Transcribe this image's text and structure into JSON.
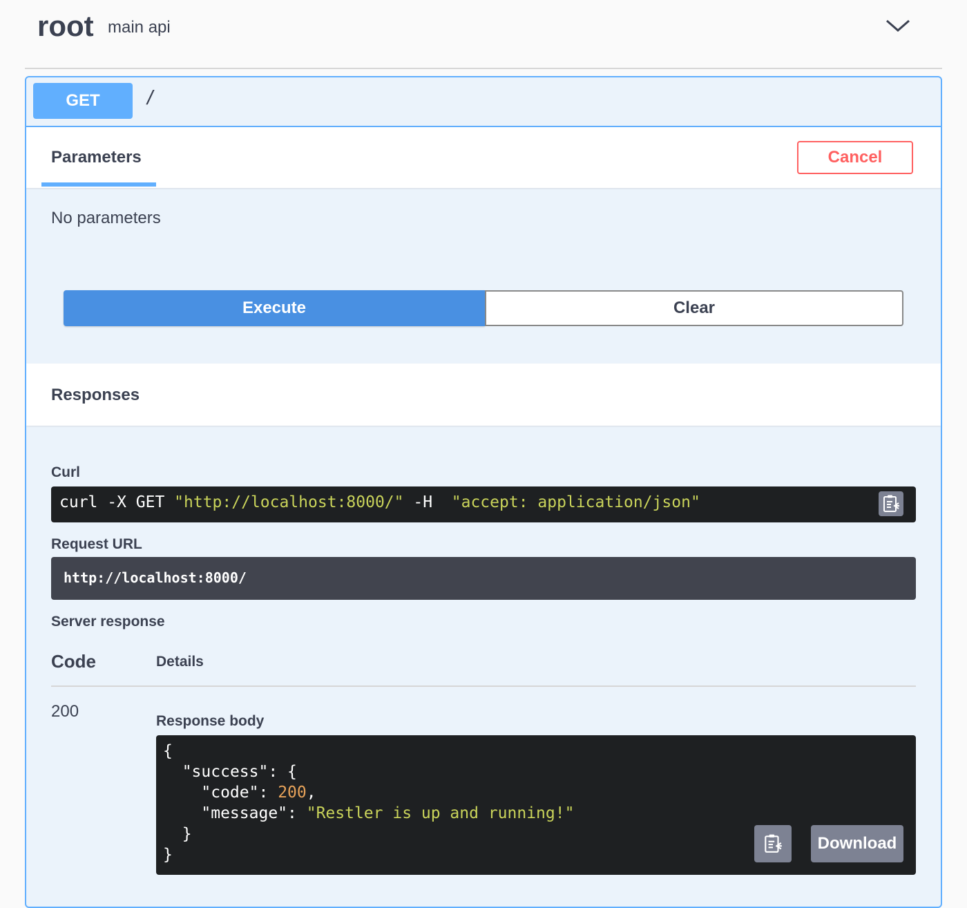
{
  "tag": {
    "name": "root",
    "description": "main api"
  },
  "operation": {
    "method": "GET",
    "path": "/"
  },
  "parameters": {
    "tab_label": "Parameters",
    "cancel_label": "Cancel",
    "empty_text": "No parameters",
    "execute_label": "Execute",
    "clear_label": "Clear"
  },
  "responses": {
    "title": "Responses",
    "curl_label": "Curl",
    "curl": {
      "prefix": "curl -X GET ",
      "url": "\"http://localhost:8000/\"",
      "flag": " -H  ",
      "header": "\"accept: application/json\""
    },
    "request_url_label": "Request URL",
    "request_url": "http://localhost:8000/",
    "server_response_label": "Server response",
    "code_header": "Code",
    "details_header": "Details",
    "status_code": "200",
    "response_body_label": "Response body",
    "body": {
      "open": "{",
      "success_key": "\"success\"",
      "code_key": "\"code\"",
      "code_value": "200",
      "message_key": "\"message\"",
      "message_value": "\"Restler is up and running!\"",
      "close": "}"
    },
    "download_label": "Download"
  },
  "colors": {
    "get_method": "#61affe",
    "execute": "#4990e2",
    "cancel": "#ff6060",
    "code_bg": "#1e2022",
    "url_bg": "#41444e",
    "string": "#c9d35a",
    "number": "#e8a35a"
  },
  "icons": {
    "expand": "chevron-down-icon",
    "copy": "clipboard-copy-icon"
  }
}
